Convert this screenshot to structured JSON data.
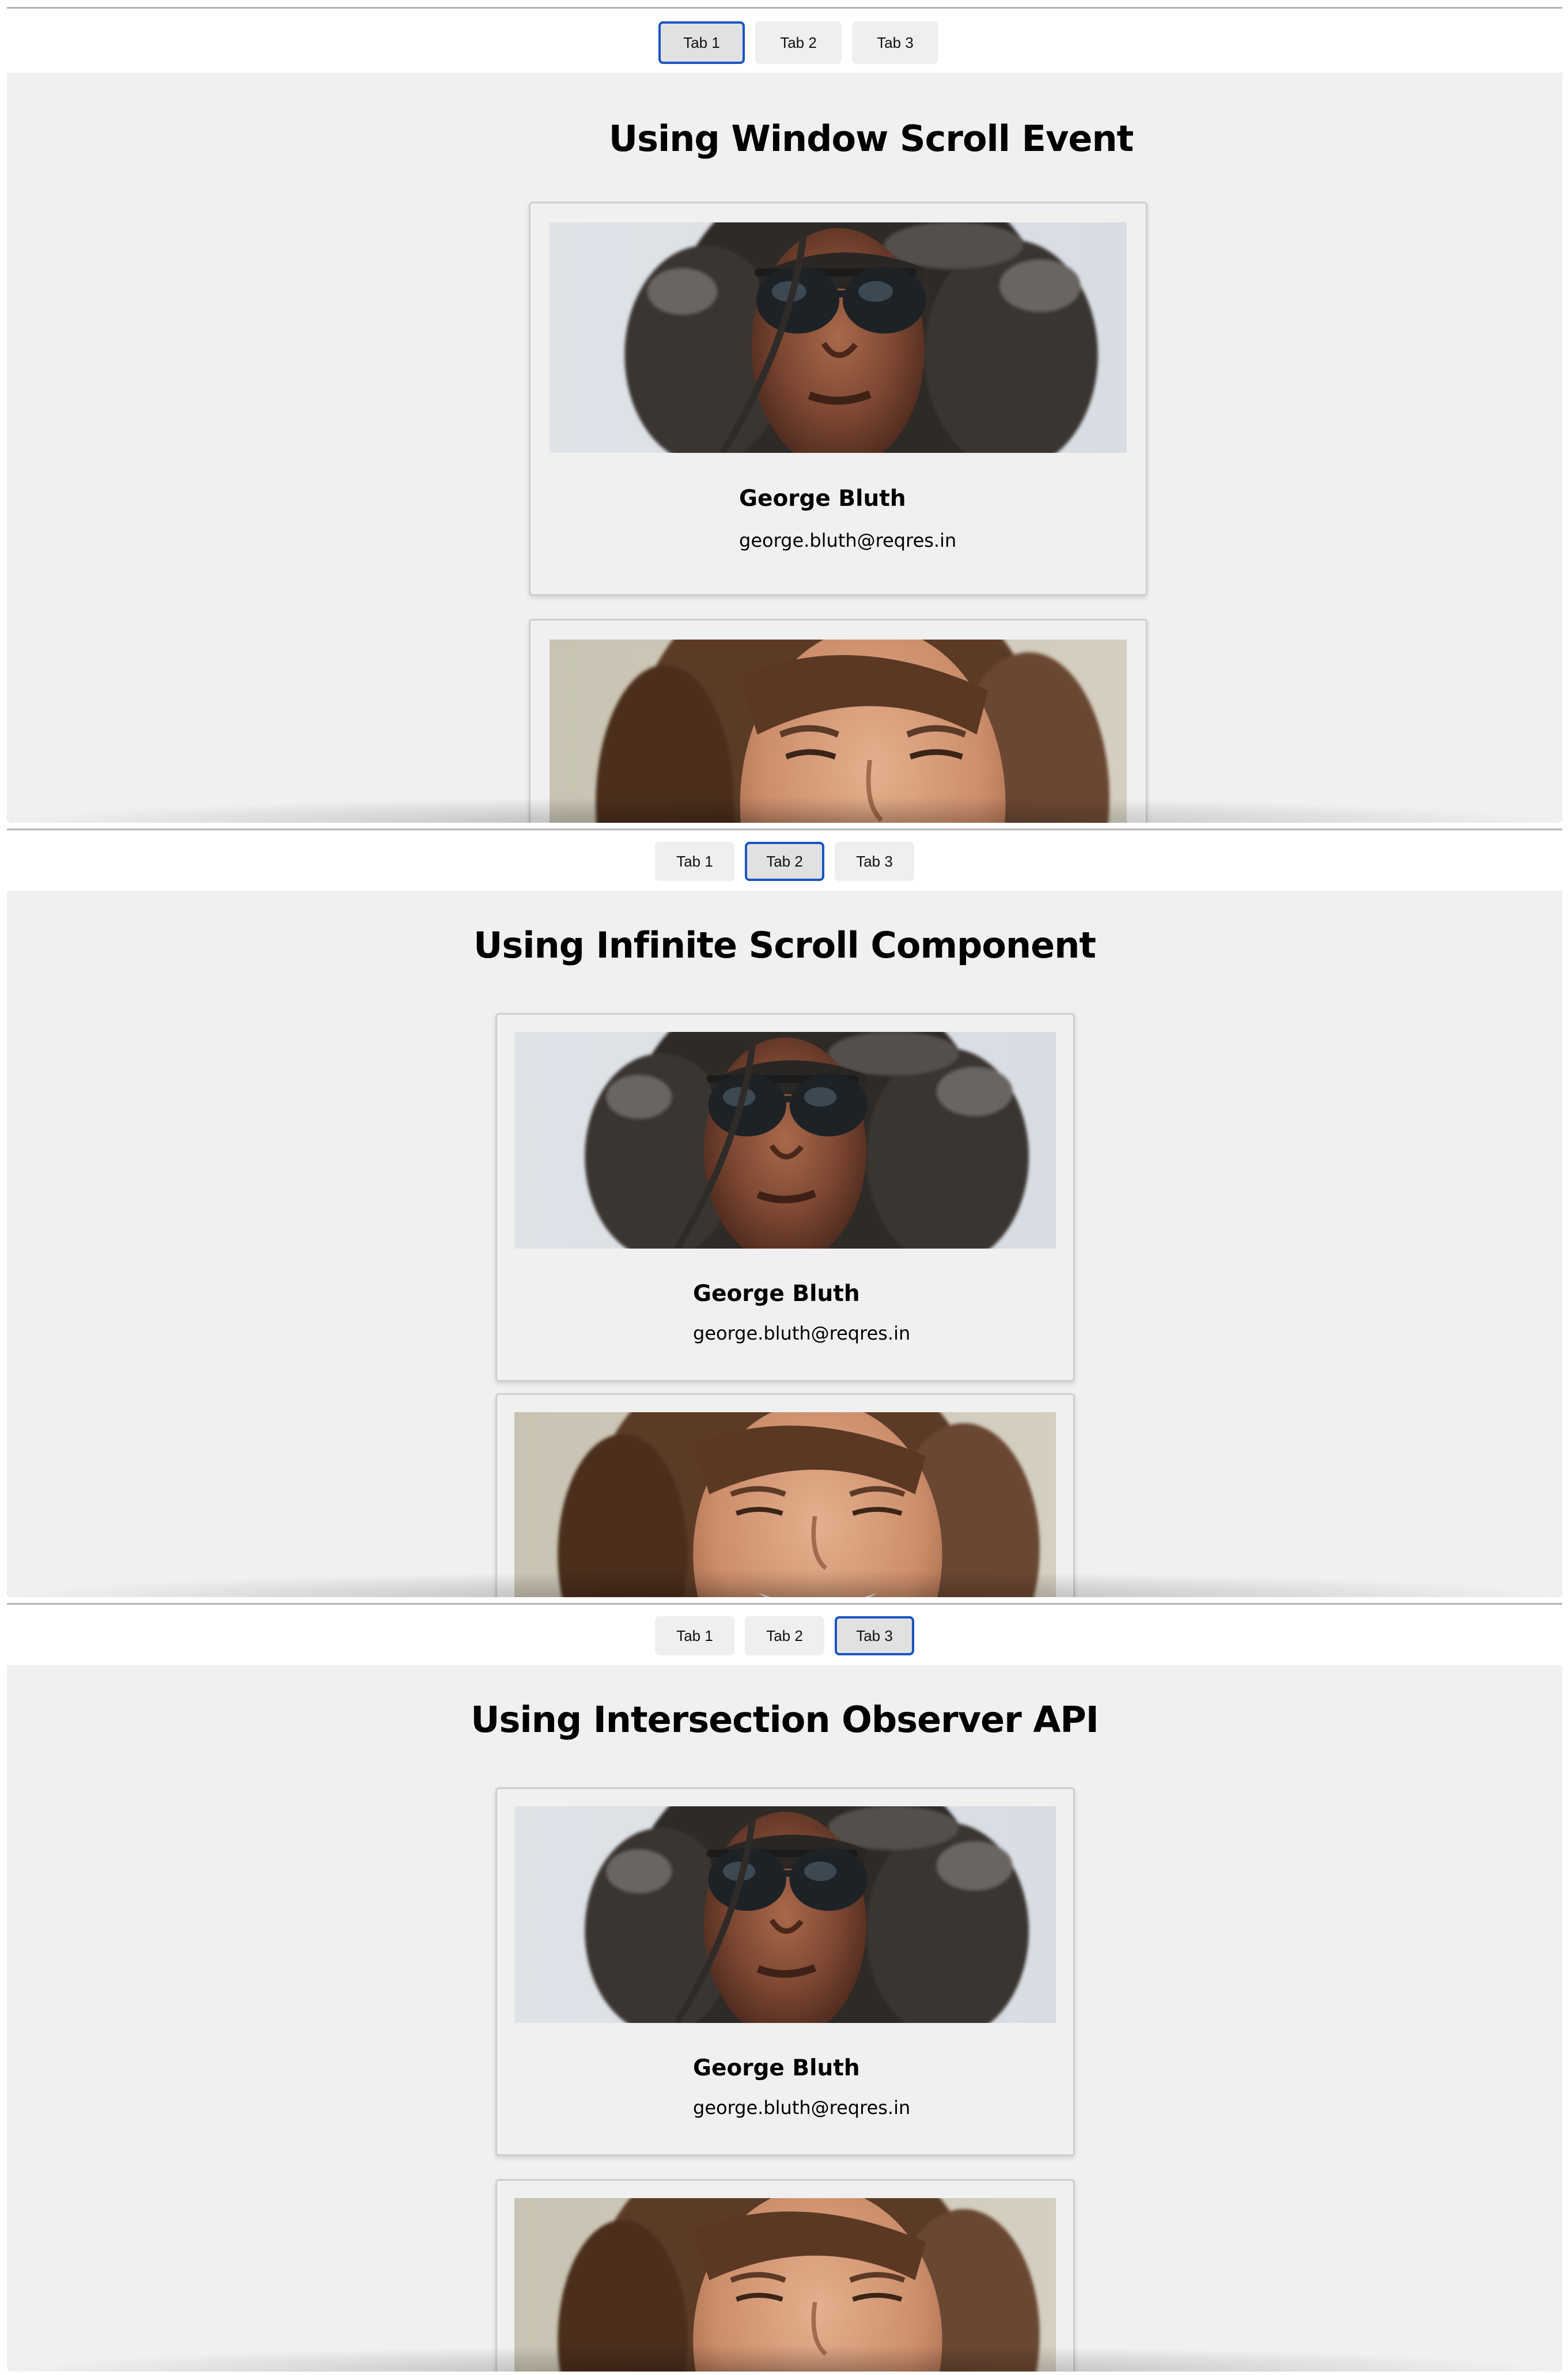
{
  "panels": [
    {
      "tabs": [
        "Tab 1",
        "Tab 2",
        "Tab 3"
      ],
      "active_tab": 0,
      "title": "Using Window Scroll Event",
      "users": [
        {
          "name": "George Bluth",
          "email": "george.bluth@reqres.in",
          "avatar": "man-sunglasses-curly-hair-photo"
        },
        {
          "avatar": "smiling-woman-photo"
        }
      ]
    },
    {
      "tabs": [
        "Tab 1",
        "Tab 2",
        "Tab 3"
      ],
      "active_tab": 1,
      "title": "Using Infinite Scroll Component",
      "users": [
        {
          "name": "George Bluth",
          "email": "george.bluth@reqres.in",
          "avatar": "man-sunglasses-curly-hair-photo"
        },
        {
          "avatar": "smiling-woman-photo"
        }
      ]
    },
    {
      "tabs": [
        "Tab 1",
        "Tab 2",
        "Tab 3"
      ],
      "active_tab": 2,
      "title": "Using Intersection Observer API",
      "users": [
        {
          "name": "George Bluth",
          "email": "george.bluth@reqres.in",
          "avatar": "man-sunglasses-curly-hair-photo"
        },
        {
          "avatar": "smiling-woman-photo"
        }
      ]
    }
  ],
  "colors": {
    "active_tab_border": "#1a55c4",
    "content_bg": "#f0f0f0",
    "tab_bg": "#efefef"
  }
}
